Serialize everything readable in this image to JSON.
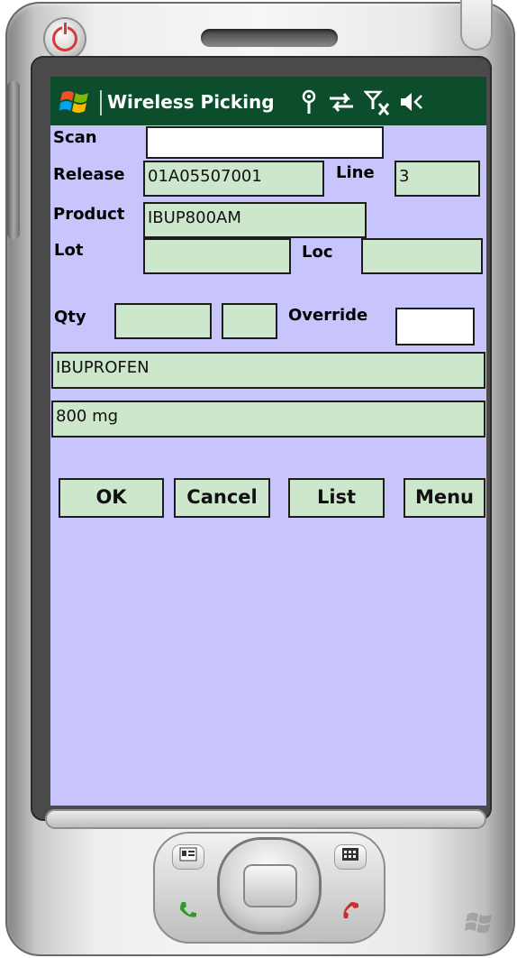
{
  "app": {
    "title": "Wireless Picking"
  },
  "form": {
    "scan": {
      "label": "Scan",
      "value": ""
    },
    "release": {
      "label": "Release",
      "value": "01A05507001"
    },
    "line": {
      "label": "Line",
      "value": "3"
    },
    "product": {
      "label": "Product",
      "value": "IBUP800AM"
    },
    "lot": {
      "label": "Lot",
      "value": ""
    },
    "loc": {
      "label": "Loc",
      "value": ""
    },
    "qty": {
      "label": "Qty",
      "value": "",
      "unit_value": ""
    },
    "override": {
      "label": "Override",
      "value": ""
    },
    "description1": "IBUPROFEN",
    "description2": "800 mg"
  },
  "buttons": {
    "ok": "OK",
    "cancel": "Cancel",
    "list": "List",
    "menu": "Menu"
  },
  "colors": {
    "titlebar": "#0c4e2c",
    "screen_bg": "#c7c5fc",
    "field_bg": "#cde7cd"
  }
}
